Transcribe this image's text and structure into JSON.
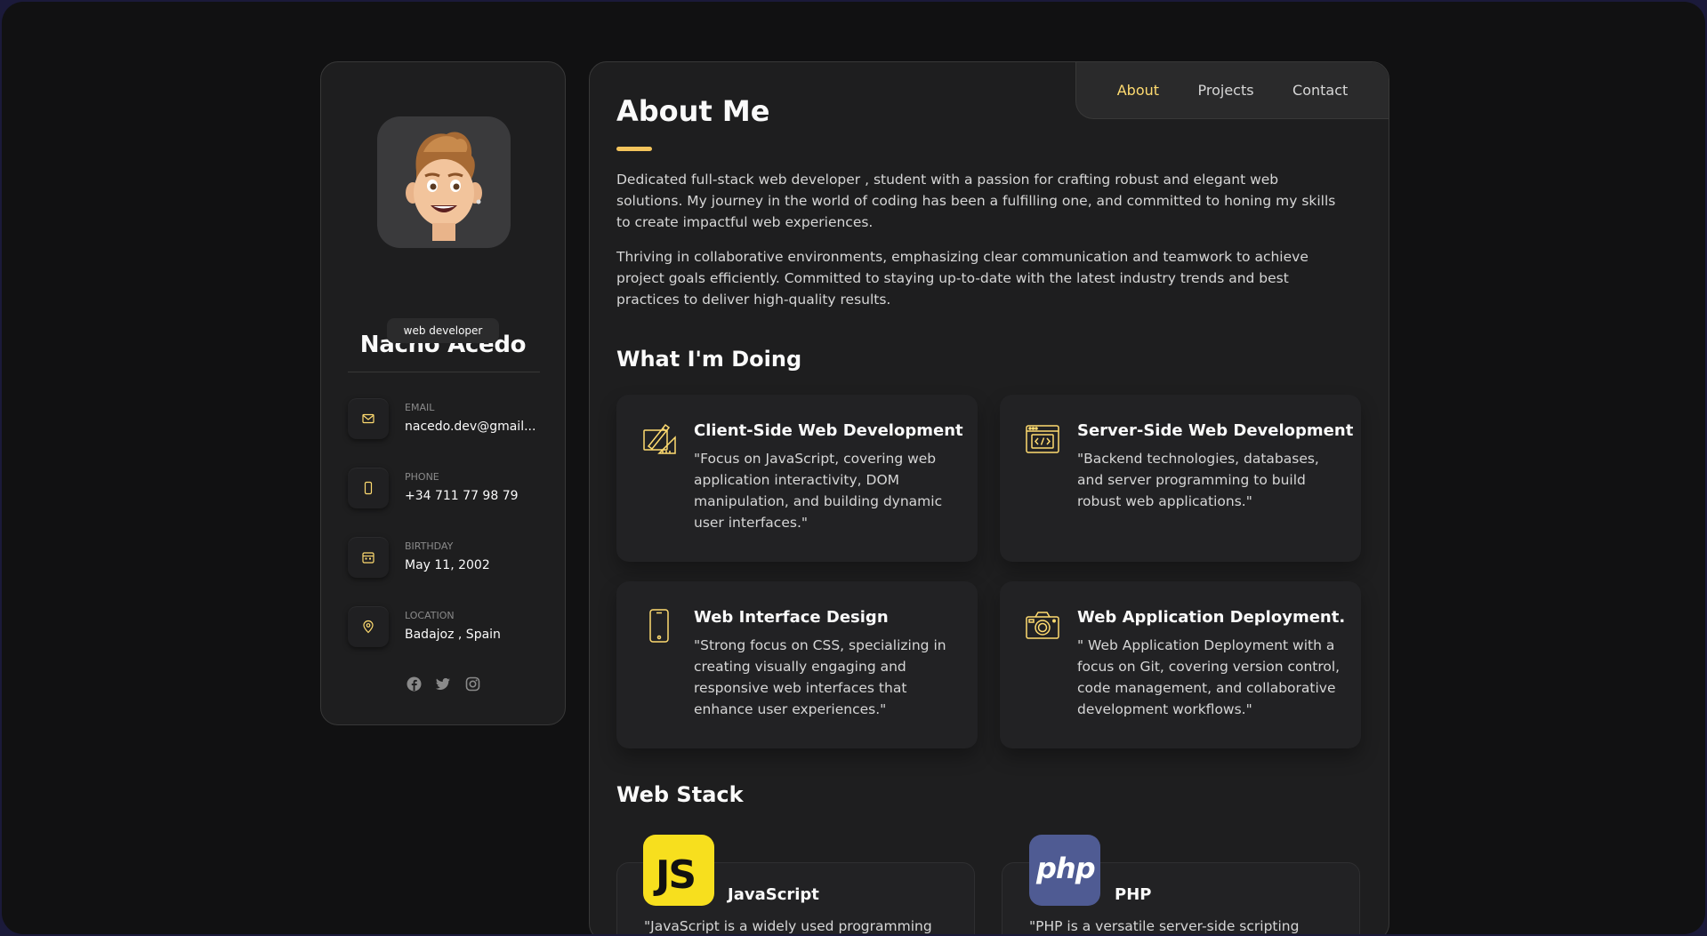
{
  "profile": {
    "name": "Nacho Acedo",
    "role": "web developer",
    "contacts": [
      {
        "label": "EMAIL",
        "value": "nacedo.dev@gmail...",
        "icon": "mail-icon"
      },
      {
        "label": "PHONE",
        "value": "+34 711 77 98 79",
        "icon": "phone-icon"
      },
      {
        "label": "BIRTHDAY",
        "value": "May 11, 2002",
        "icon": "calendar-icon"
      },
      {
        "label": "LOCATION",
        "value": "Badajoz , Spain",
        "icon": "location-pin-icon"
      }
    ],
    "socials": [
      "facebook-icon",
      "twitter-icon",
      "instagram-icon"
    ]
  },
  "nav": {
    "about": "About",
    "projects": "Projects",
    "contact": "Contact"
  },
  "about": {
    "title": "About Me",
    "paragraphs": [
      "Dedicated full-stack web developer , student with a passion for crafting robust and elegant web solutions. My journey in the world of coding has been a fulfilling one, and committed to honing my skills to create impactful web experiences.",
      "Thriving in collaborative environments, emphasizing clear communication and teamwork to achieve project goals efficiently. Committed to staying up-to-date with the latest industry trends and best practices to deliver high-quality results."
    ]
  },
  "services": {
    "title": "What I'm Doing",
    "items": [
      {
        "title": "Client-Side Web Development",
        "text": "\"Focus on JavaScript, covering web application interactivity, DOM manipulation, and building dynamic user interfaces.\"",
        "icon": "design-tools-icon"
      },
      {
        "title": "Server-Side Web Development",
        "text": "\"Backend technologies, databases, and server programming to build robust web applications.\"",
        "icon": "code-window-icon"
      },
      {
        "title": "Web Interface Design",
        "text": "\"Strong focus on CSS, specializing in creating visually engaging and responsive web interfaces that enhance user experiences.\"",
        "icon": "smartphone-icon"
      },
      {
        "title": "Web Application Deployment.",
        "text": "\" Web Application Deployment with a focus on Git, covering version control, code management, and collaborative development workflows.\"",
        "icon": "camera-icon"
      }
    ]
  },
  "stack": {
    "title": "Web Stack",
    "items": [
      {
        "name": "JavaScript",
        "logo": "JS",
        "text": "\"JavaScript is a widely used programming",
        "color": "#f7df1e"
      },
      {
        "name": "PHP",
        "logo": "php",
        "text": "\"PHP is a versatile server-side scripting",
        "color": "#4f5b93"
      }
    ]
  },
  "colors": {
    "accent": "#ffdb70",
    "background": "#111112",
    "panel": "#1e1e1f"
  }
}
